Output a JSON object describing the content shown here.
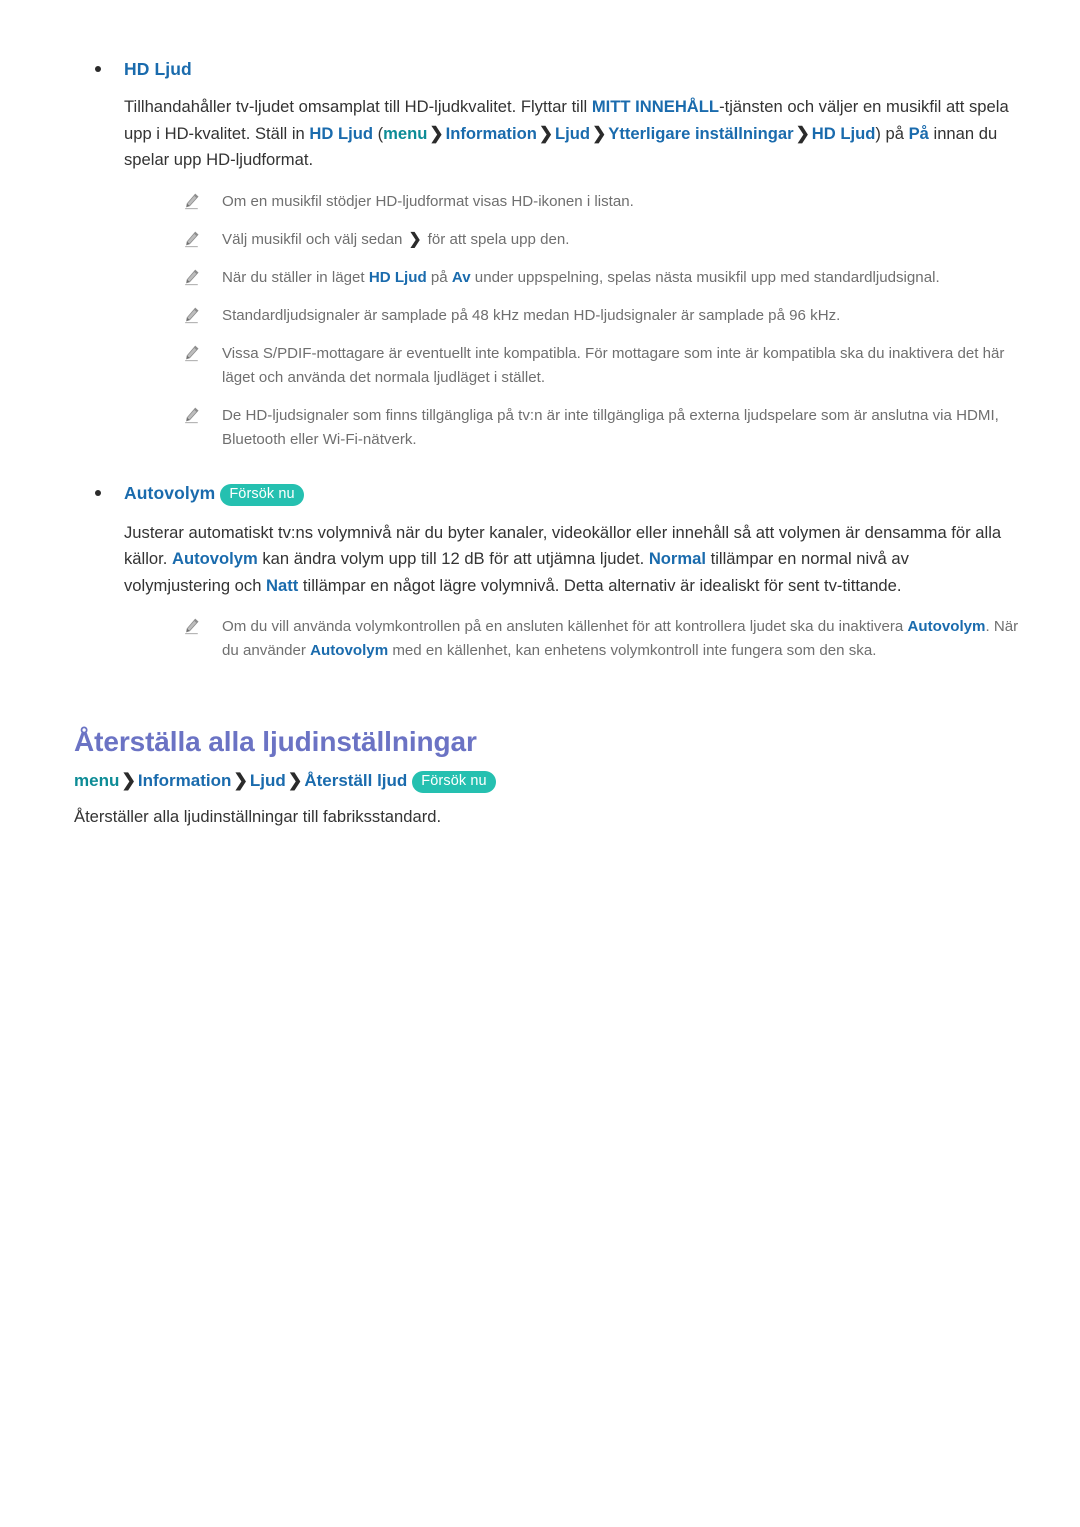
{
  "features": [
    {
      "title": "HD Ljud",
      "badge": null,
      "body": {
        "lead": "Tillhandahåller tv-ljudet omsamplat till HD-ljudkvalitet. Flyttar till ",
        "service": "MITT INNEHÅLL",
        "after_service": "-tjänsten och väljer en musikfil att spela upp i HD-kvalitet. Ställ in ",
        "setting": "HD Ljud",
        "open_paren": " (",
        "path": [
          "menu",
          "Information",
          "Ljud",
          "Ytterligare inställningar",
          "HD Ljud"
        ],
        "close_paren": ")",
        "tail_pre": " på ",
        "value": "På",
        "tail": " innan du spelar upp HD-ljudformat."
      },
      "notes": [
        {
          "parts": [
            {
              "text": "Om en musikfil stödjer HD-ljudformat visas HD-ikonen i listan.",
              "style": "plain"
            }
          ]
        },
        {
          "parts": [
            {
              "text": "Välj musikfil och välj sedan ",
              "style": "plain"
            },
            {
              "text": "❯",
              "style": "chevron"
            },
            {
              "text": " för att spela upp den.",
              "style": "plain"
            }
          ]
        },
        {
          "parts": [
            {
              "text": "När du ställer in läget ",
              "style": "plain"
            },
            {
              "text": "HD Ljud",
              "style": "key"
            },
            {
              "text": " på ",
              "style": "plain"
            },
            {
              "text": "Av",
              "style": "key"
            },
            {
              "text": " under uppspelning, spelas nästa musikfil upp med standardljudsignal.",
              "style": "plain"
            }
          ]
        },
        {
          "parts": [
            {
              "text": "Standardljudsignaler är samplade på 48 kHz medan HD-ljudsignaler är samplade på 96 kHz.",
              "style": "plain"
            }
          ]
        },
        {
          "parts": [
            {
              "text": "Vissa S/PDIF-mottagare är eventuellt inte kompatibla. För mottagare som inte är kompatibla ska du inaktivera det här läget och använda det normala ljudläget i stället.",
              "style": "plain"
            }
          ]
        },
        {
          "parts": [
            {
              "text": "De HD-ljudsignaler som finns tillgängliga på tv:n är inte tillgängliga på externa ljudspelare som är anslutna via HDMI, Bluetooth eller Wi-Fi-nätverk.",
              "style": "plain"
            }
          ]
        }
      ]
    },
    {
      "title": "Autovolym",
      "badge": "Försök nu",
      "body": {
        "lead": "Justerar automatiskt tv:ns volymnivå när du byter kanaler, videokällor eller innehåll så att volymen är densamma för alla källor. ",
        "term1": "Autovolym",
        "mid1": " kan ändra volym upp till 12 dB för att utjämna ljudet. ",
        "term2": "Normal",
        "mid2": " tillämpar en normal nivå av volymjustering och ",
        "term3": "Natt",
        "tail": " tillämpar en något lägre volymnivå. Detta alternativ är idealiskt för sent tv-tittande."
      },
      "notes": [
        {
          "parts": [
            {
              "text": "Om du vill använda volymkontrollen på en ansluten källenhet för att kontrollera ljudet ska du inaktivera ",
              "style": "plain"
            },
            {
              "text": "Autovolym",
              "style": "key"
            },
            {
              "text": ". När du använder ",
              "style": "plain"
            },
            {
              "text": "Autovolym",
              "style": "key"
            },
            {
              "text": " med en källenhet, kan enhetens volymkontroll inte fungera som den ska.",
              "style": "plain"
            }
          ]
        }
      ]
    }
  ],
  "chapter": {
    "title": "Återställa alla ljudinställningar",
    "path": [
      "menu",
      "Information",
      "Ljud",
      "Återställ ljud"
    ],
    "badge": "Försök nu",
    "description": "Återställer alla ljudinställningar till fabriksstandard."
  },
  "icons": {
    "note": "pencil-icon",
    "chevron": "chevron-right-icon",
    "bullet": "bullet-dot-icon"
  },
  "colors": {
    "key_blue": "#1a6bad",
    "menu_teal": "#0d8c96",
    "badge_teal": "#25c0b0",
    "chapter_purple": "#6b73c4",
    "body_text": "#333333",
    "note_text": "#6f6f6f"
  }
}
